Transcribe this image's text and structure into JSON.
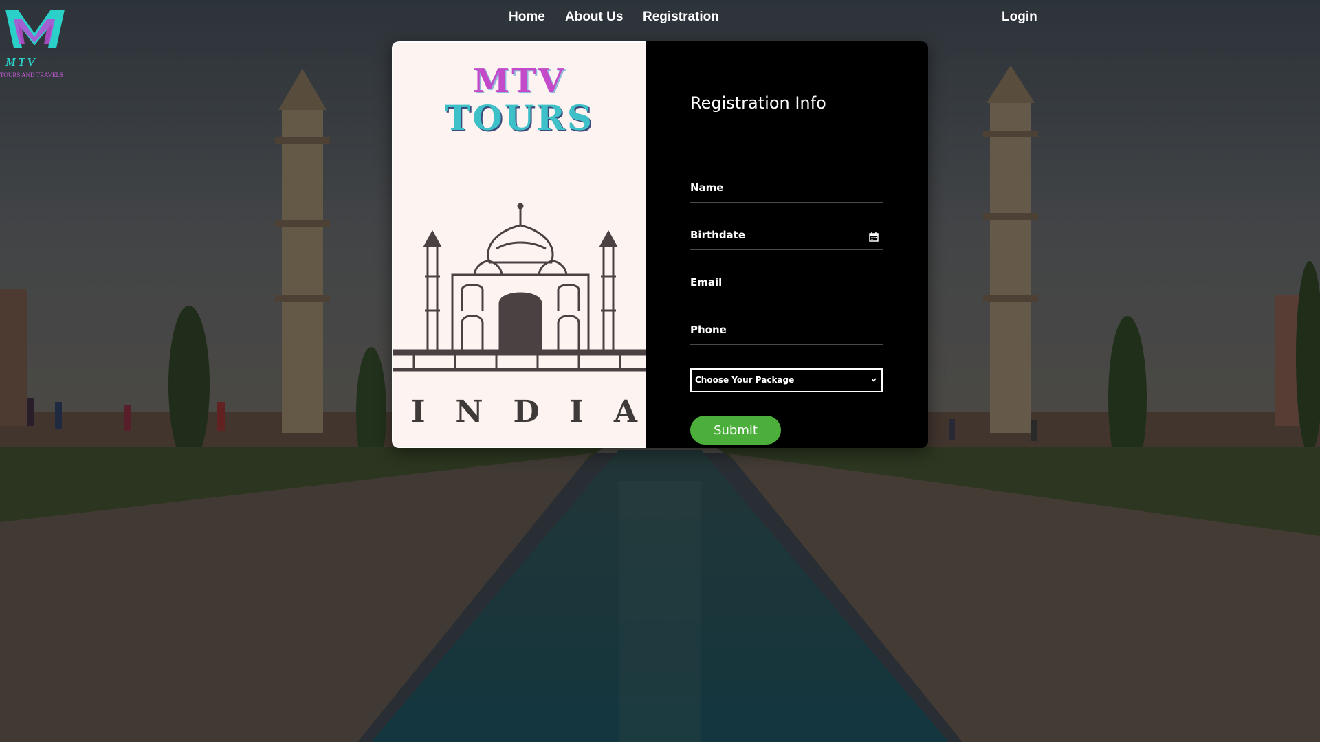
{
  "colors": {
    "accent_green": "#4caf3c",
    "panel_dark": "#000000",
    "panel_light": "#fdf4f1",
    "brand_pink": "#c34bc9",
    "brand_teal": "#3ec0c8"
  },
  "logo": {
    "icon": "mtv-logo-icon",
    "line1": "MTV",
    "line2": "TOURS AND TRAVELS"
  },
  "nav": {
    "home": "Home",
    "about": "About Us",
    "registration": "Registration",
    "login": "Login"
  },
  "promo": {
    "brand_line1": "MTV",
    "brand_line2": "TOURS",
    "illustration": "taj-mahal-sketch",
    "country_letters": [
      "I",
      "N",
      "D",
      "I",
      "A"
    ]
  },
  "form": {
    "title": "Registration Info",
    "name_placeholder": "Name",
    "birthdate_placeholder": "Birthdate",
    "email_placeholder": "Email",
    "phone_placeholder": "Phone",
    "package_selected": "Choose Your Package",
    "submit_label": "Submit"
  }
}
